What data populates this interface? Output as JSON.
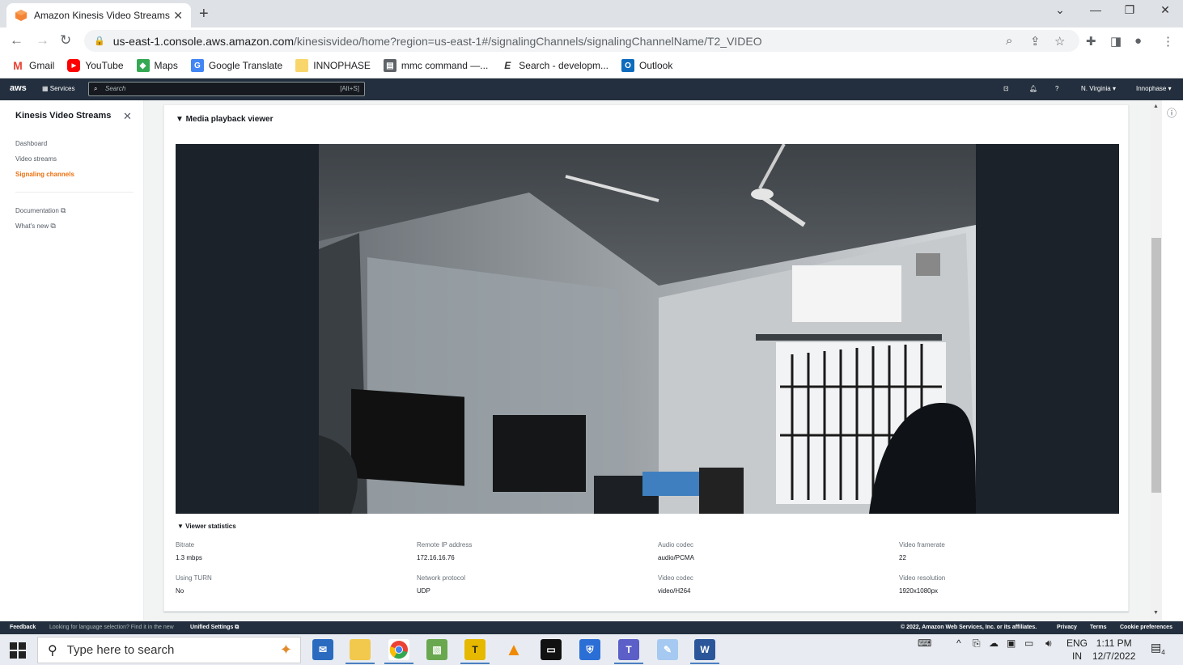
{
  "browser": {
    "tab_title": "Amazon Kinesis Video Streams",
    "tab_close": "✕",
    "new_tab": "+",
    "url_host": "us-east-1.console.aws.amazon.com",
    "url_path": "/kinesisvideo/home?region=us-east-1#/signalingChannels/signalingChannelName/T2_VIDEO",
    "bookmarks": [
      {
        "label": "Gmail",
        "icon": "gmail-icon",
        "color": "#ea4335"
      },
      {
        "label": "YouTube",
        "icon": "youtube-icon",
        "color": "#ff0000"
      },
      {
        "label": "Maps",
        "icon": "maps-icon",
        "color": "#34a853"
      },
      {
        "label": "Google Translate",
        "icon": "translate-icon",
        "color": "#4285f4"
      },
      {
        "label": "INNOPHASE",
        "icon": "folder-icon",
        "color": "#f9d66b"
      },
      {
        "label": "mmc command —...",
        "icon": "document-icon",
        "color": "#5f6368"
      },
      {
        "label": "Search - developm...",
        "icon": "e-icon",
        "color": "#333333"
      },
      {
        "label": "Outlook",
        "icon": "outlook-icon",
        "color": "#0f6cbd"
      }
    ]
  },
  "aws_header": {
    "logo": "aws",
    "services": "Services",
    "search_placeholder": "Search",
    "search_hint": "[Alt+S]",
    "region": "N. Virginia ▾",
    "account": "Innophase ▾"
  },
  "sidebar": {
    "title": "Kinesis Video Streams",
    "items": [
      {
        "label": "Dashboard"
      },
      {
        "label": "Video streams"
      },
      {
        "label": "Signaling channels"
      }
    ],
    "links": [
      {
        "label": "Documentation"
      },
      {
        "label": "What's new"
      }
    ]
  },
  "panel": {
    "title": "▼  Media playback viewer",
    "stats_title": "▼  Viewer statistics",
    "stats": [
      {
        "label": "Bitrate",
        "value": "1.3 mbps"
      },
      {
        "label": "Remote IP address",
        "value": "172.16.16.76"
      },
      {
        "label": "Audio codec",
        "value": "audio/PCMA"
      },
      {
        "label": "Video framerate",
        "value": "22"
      },
      {
        "label": "Using TURN",
        "value": "No"
      },
      {
        "label": "Network protocol",
        "value": "UDP"
      },
      {
        "label": "Video codec",
        "value": "video/H264"
      },
      {
        "label": "Video resolution",
        "value": "1920x1080px"
      }
    ]
  },
  "aws_footer": {
    "feedback": "Feedback",
    "language_prompt": "Looking for language selection? Find it in the new",
    "unified_settings": "Unified Settings",
    "copyright": "© 2022, Amazon Web Services, Inc. or its affiliates.",
    "privacy": "Privacy",
    "terms": "Terms",
    "cookie": "Cookie preferences"
  },
  "taskbar": {
    "search_placeholder": "Type here to search",
    "lang_top": "ENG",
    "lang_bottom": "IN",
    "time": "1:11 PM",
    "date": "12/7/2022",
    "notifications": "4"
  }
}
